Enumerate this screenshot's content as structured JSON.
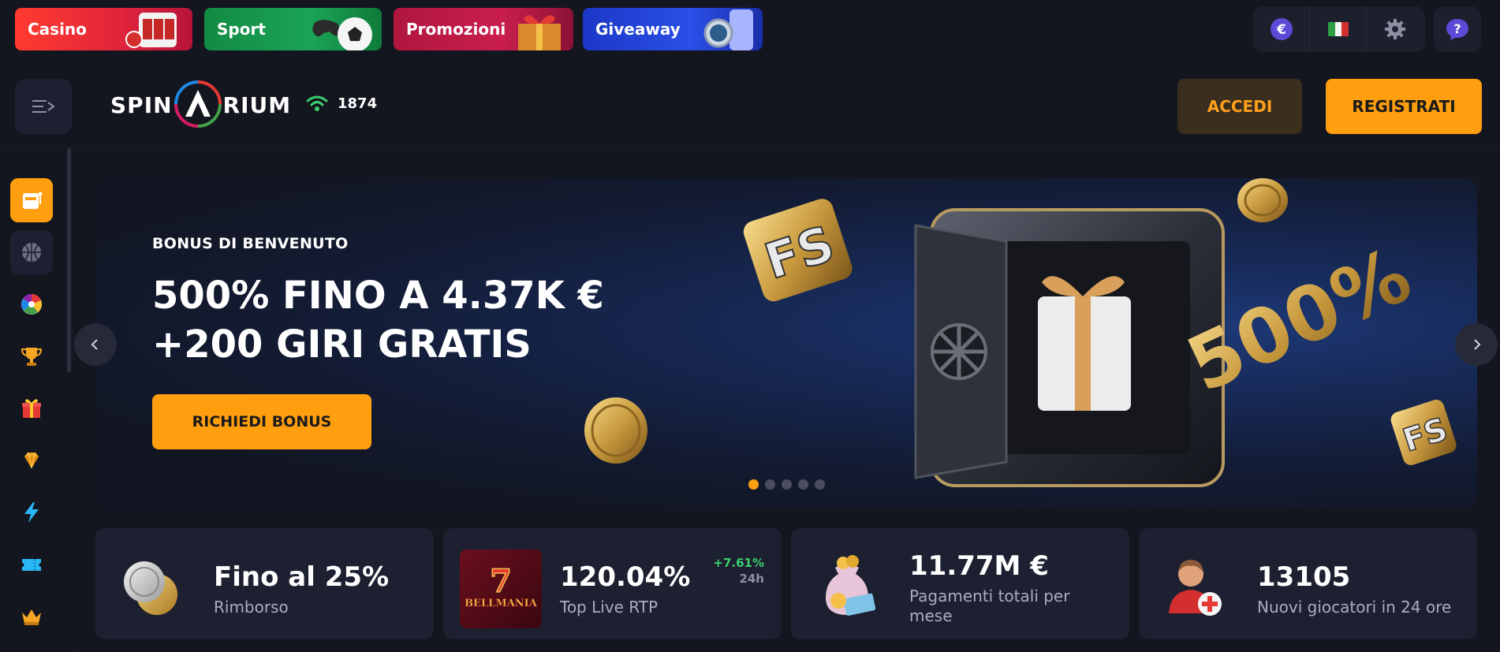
{
  "promos": [
    {
      "label": "Casino"
    },
    {
      "label": "Sport"
    },
    {
      "label": "Promozioni"
    },
    {
      "label": "Giveaway"
    }
  ],
  "topright": {
    "currency_symbol": "€",
    "help_symbol": "?"
  },
  "header": {
    "logo_left": "SPIN",
    "logo_right": "RIUM",
    "online_count": "1874",
    "login_label": "ACCEDI",
    "register_label": "REGISTRATI"
  },
  "sidebar": {
    "items": [
      {
        "icon": "slot-machine-icon",
        "active": true
      },
      {
        "icon": "basketball-icon"
      },
      {
        "icon": "roulette-wheel-icon"
      },
      {
        "icon": "trophy-icon"
      },
      {
        "icon": "gift-icon"
      },
      {
        "icon": "diamond-icon"
      },
      {
        "icon": "lightning-icon"
      },
      {
        "icon": "ticket-icon"
      },
      {
        "icon": "crown-icon"
      }
    ]
  },
  "hero": {
    "kicker": "BONUS DI BENVENUTO",
    "title_line1": "500% FINO A 4.37K €",
    "title_line2": "+200 GIRI GRATIS",
    "cta": "RICHIEDI BONUS",
    "badge_fs": "FS",
    "badge_percent": "500%",
    "slides_total": 5,
    "active_slide": 1
  },
  "stats": [
    {
      "value": "Fino al 25%",
      "caption": "Rimborso"
    },
    {
      "value": "120.04%",
      "caption": "Top Live RTP",
      "delta": "+7.61%",
      "period": "24h",
      "game_logo": "BELLMANIA"
    },
    {
      "value": "11.77M €",
      "caption_line1": "Pagamenti totali per",
      "caption_line2": "mese"
    },
    {
      "value": "13105",
      "caption": "Nuovi giocatori in 24 ore"
    }
  ],
  "colors": {
    "accent": "#ff9f10",
    "bg": "#13151f",
    "card": "#1d2030",
    "positive": "#3ccf6e"
  }
}
